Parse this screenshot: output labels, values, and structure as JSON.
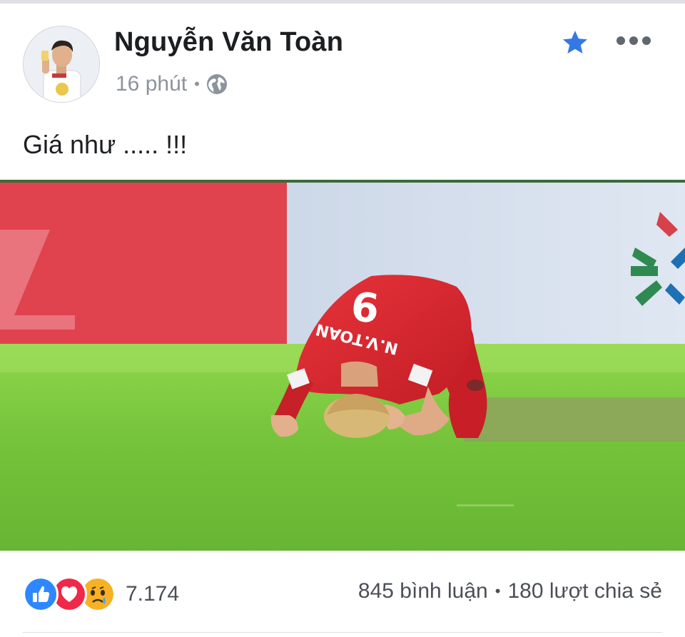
{
  "post": {
    "author": "Nguyễn Văn Toàn",
    "time": "16 phút",
    "separator": "•",
    "audience_icon": "globe-icon",
    "caption": "Giá như ..... !!!",
    "actions": {
      "favorite_icon": "star-icon",
      "more_icon": "more-icon"
    }
  },
  "photo": {
    "jersey_number": "9",
    "jersey_name": "N.V.TOAN"
  },
  "footer": {
    "reaction_icons": [
      "like-icon",
      "love-icon",
      "sad-icon"
    ],
    "reaction_count": "7.174",
    "comments": "845 bình luận",
    "separator": "•",
    "shares": "180 lượt chia sẻ"
  },
  "colors": {
    "accent_star": "#3578e5",
    "like": "#2d88ff",
    "love": "#f02849",
    "sad": "#f7b125",
    "meta_gray": "#8d949e"
  }
}
